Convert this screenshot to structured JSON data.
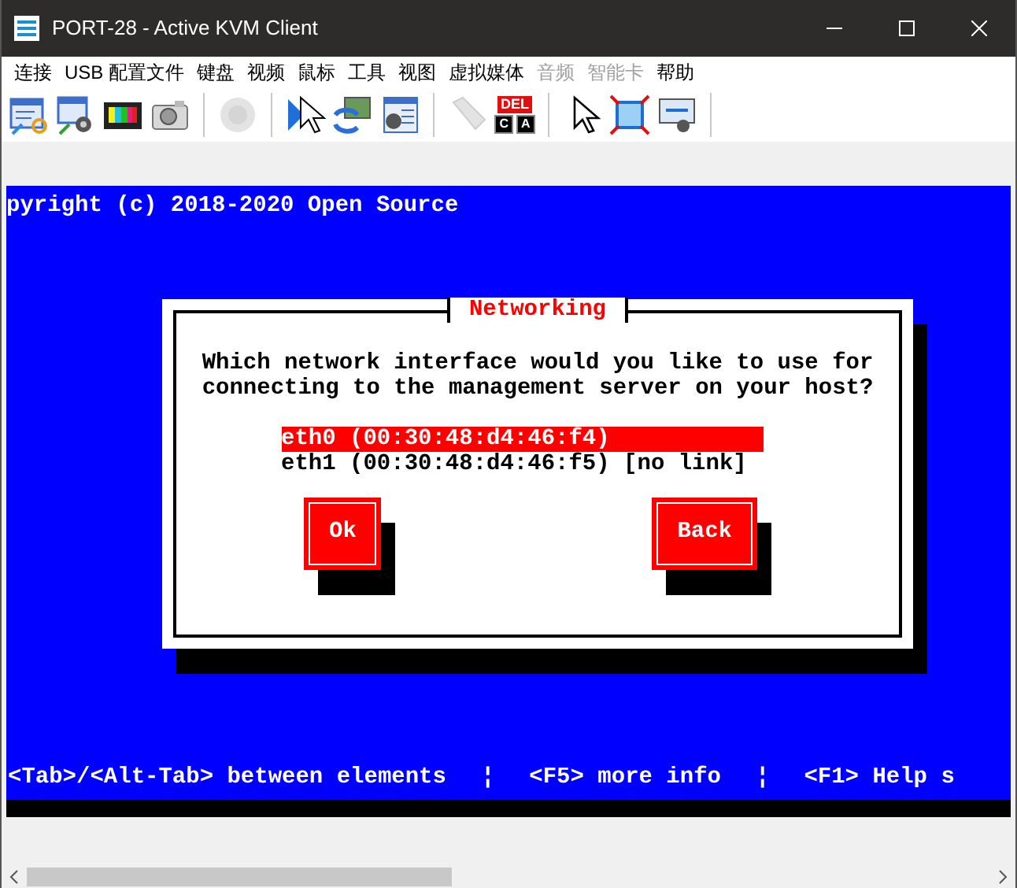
{
  "window": {
    "title": "PORT-28 - Active KVM Client"
  },
  "menu": [
    {
      "label": "连接",
      "disabled": false
    },
    {
      "label": "USB 配置文件",
      "disabled": false
    },
    {
      "label": "键盘",
      "disabled": false
    },
    {
      "label": "视频",
      "disabled": false
    },
    {
      "label": "鼠标",
      "disabled": false
    },
    {
      "label": "工具",
      "disabled": false
    },
    {
      "label": "视图",
      "disabled": false
    },
    {
      "label": "虚拟媒体",
      "disabled": false
    },
    {
      "label": "音频",
      "disabled": true
    },
    {
      "label": "智能卡",
      "disabled": true
    },
    {
      "label": "帮助",
      "disabled": false
    }
  ],
  "toolbar": [
    {
      "kind": "connect",
      "disabled": false
    },
    {
      "kind": "webcam-connect",
      "disabled": false
    },
    {
      "kind": "color-bars",
      "disabled": false
    },
    {
      "kind": "camera",
      "disabled": false
    },
    {
      "kind": "separator"
    },
    {
      "kind": "speaker",
      "disabled": true
    },
    {
      "kind": "separator"
    },
    {
      "kind": "cursor-blue",
      "disabled": false
    },
    {
      "kind": "sync",
      "disabled": false
    },
    {
      "kind": "webcam-panel",
      "disabled": false
    },
    {
      "kind": "separator"
    },
    {
      "kind": "usb",
      "disabled": true
    },
    {
      "kind": "ctrl-alt-del",
      "label": "DEL",
      "keys": [
        "C",
        "A"
      ],
      "disabled": false
    },
    {
      "kind": "separator"
    },
    {
      "kind": "cursor",
      "disabled": false
    },
    {
      "kind": "fullscreen",
      "disabled": false
    },
    {
      "kind": "scale",
      "disabled": false
    },
    {
      "kind": "separator"
    }
  ],
  "console": {
    "copyright": "pyright (c) 2018-2020 Open Source",
    "dialog": {
      "title": "Networking",
      "prompt": [
        "Which network interface would you like to use for",
        "connecting to the management server on your host?"
      ],
      "interfaces": [
        {
          "label": "eth0 (00:30:48:d4:46:f4)",
          "selected": true
        },
        {
          "label": "eth1 (00:30:48:d4:46:f5) [no link]",
          "selected": false
        }
      ],
      "buttons": [
        "Ok",
        "Back"
      ]
    },
    "help_line": [
      "<Tab>/<Alt-Tab> between elements",
      "¦",
      "<F5> more info",
      "¦",
      "<F1> Help s"
    ]
  }
}
